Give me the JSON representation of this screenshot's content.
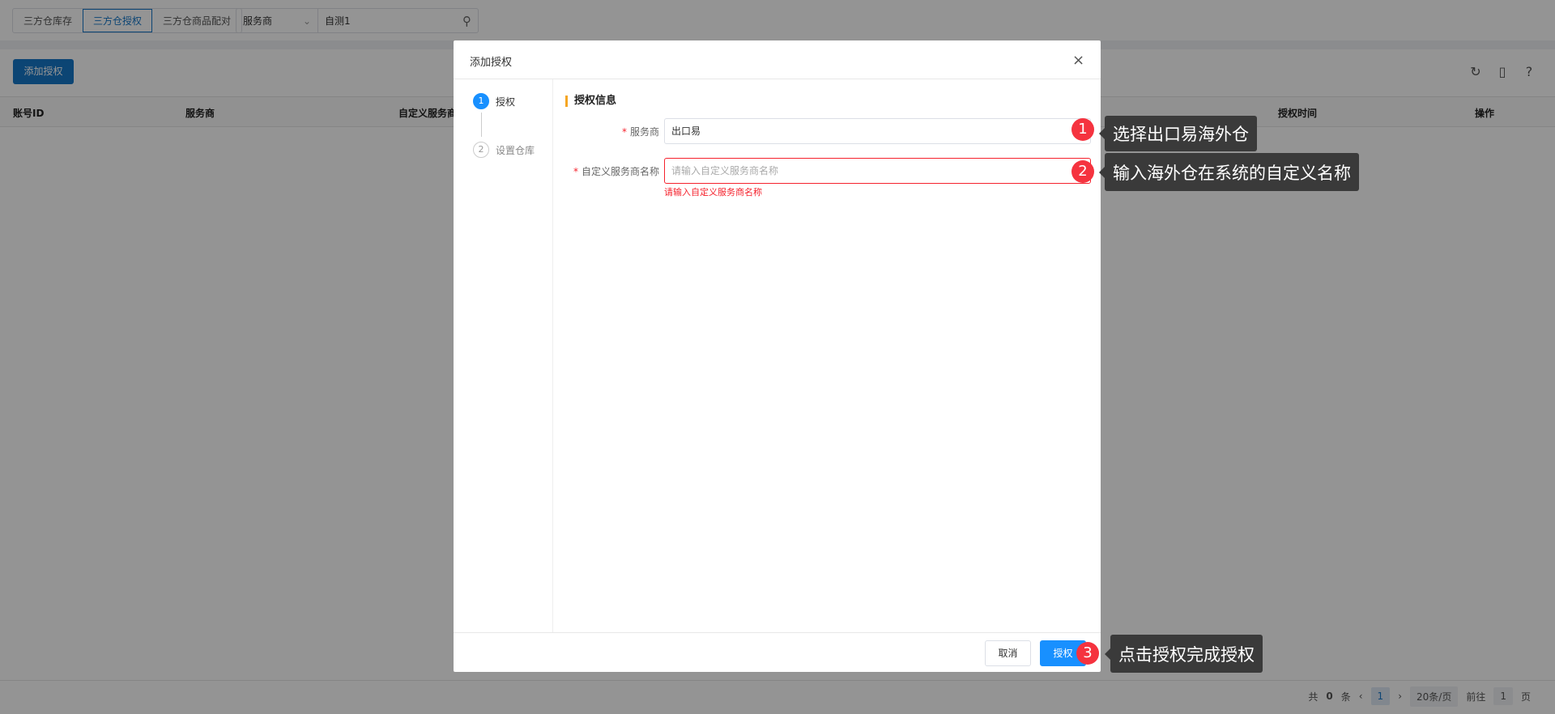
{
  "tabs": [
    "三方仓库存",
    "三方仓授权",
    "三方仓商品配对"
  ],
  "active_tab": 1,
  "search": {
    "field": "服务商",
    "value": "自测1"
  },
  "add_button": "添加授权",
  "table": {
    "columns": [
      "账号ID",
      "服务商",
      "自定义服务商",
      "授权时间",
      "操作"
    ]
  },
  "pager": {
    "total_prefix": "共",
    "total": "0",
    "total_suffix": "条",
    "current": "1",
    "page_size": "20条/页",
    "goto_label": "前往",
    "goto_value": "1",
    "goto_suffix": "页"
  },
  "modal": {
    "title": "添加授权",
    "steps": [
      {
        "num": "1",
        "label": "授权"
      },
      {
        "num": "2",
        "label": "设置仓库"
      }
    ],
    "section_title": "授权信息",
    "fields": [
      {
        "label": "服务商",
        "value": "出口易"
      },
      {
        "label": "自定义服务商名称",
        "placeholder": "请输入自定义服务商名称",
        "error": "请输入自定义服务商名称"
      }
    ],
    "cancel": "取消",
    "submit": "授权"
  },
  "annotations": [
    {
      "num": "1",
      "text": "选择出口易海外仓"
    },
    {
      "num": "2",
      "text": "输入海外仓在系统的自定义名称"
    },
    {
      "num": "3",
      "text": "点击授权完成授权"
    }
  ],
  "colors": {
    "primary": "#1677c8",
    "modal_primary": "#1890ff",
    "error": "#f5222d",
    "badge": "#f5333f"
  }
}
